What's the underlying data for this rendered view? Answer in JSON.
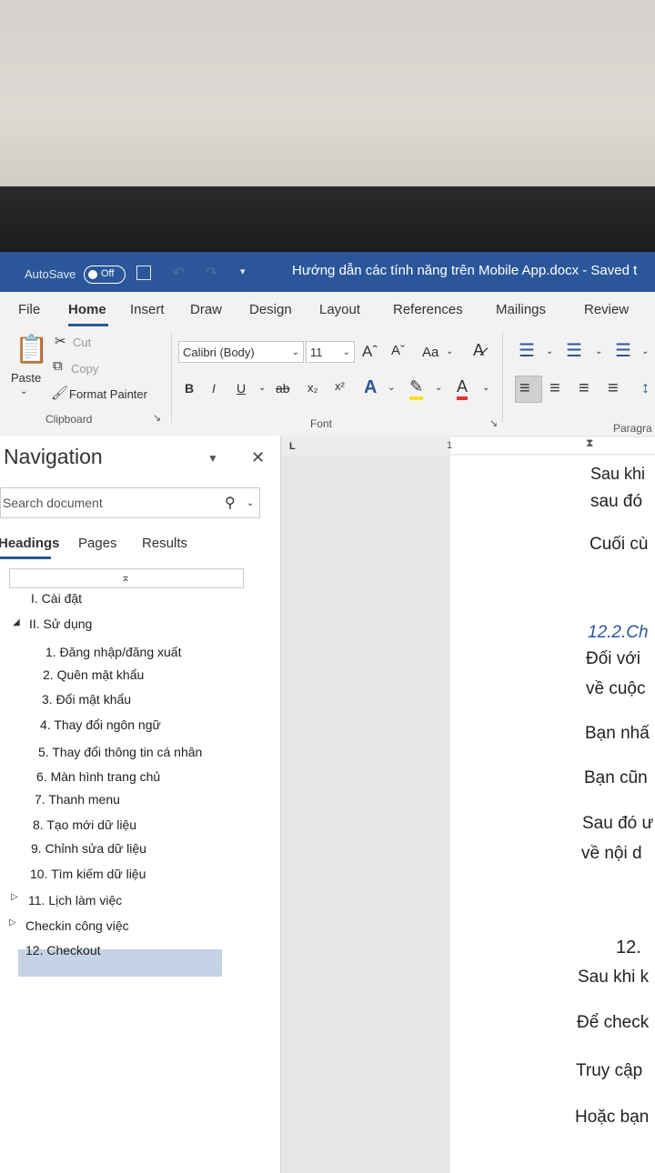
{
  "titlebar": {
    "autosave": "AutoSave",
    "toggle": "Off",
    "title": "Hướng dẫn các tính năng trên Mobile App.docx  -  Saved t"
  },
  "tabs": [
    "File",
    "Home",
    "Insert",
    "Draw",
    "Design",
    "Layout",
    "References",
    "Mailings",
    "Review"
  ],
  "clipboard": {
    "paste": "Paste",
    "cut": "Cut",
    "copy": "Copy",
    "format_painter": "Format Painter",
    "group": "Clipboard"
  },
  "font": {
    "name": "Calibri (Body)",
    "size": "11",
    "group": "Font",
    "change_case": "Aa"
  },
  "paragraph": {
    "group": "Paragra"
  },
  "nav": {
    "title": "Navigation",
    "search_placeholder": "Search document",
    "tabs": [
      "Headings",
      "Pages",
      "Results"
    ],
    "headings": [
      "I. Cài đặt",
      "II. Sử dụng",
      "1. Đăng nhập/đăng xuất",
      "2. Quên mật khẩu",
      "3. Đổi mật khẩu",
      "4. Thay đổi ngôn ngữ",
      "5. Thay đổi thông tin cá nhân",
      "6. Màn hình trang chủ",
      "7. Thanh menu",
      "8. Tạo mới dữ liệu",
      "9. Chỉnh sửa dữ liệu",
      "10. Tìm kiếm dữ liệu",
      "11. Lịch làm việc",
      "Checkin công việc",
      "12. Checkout"
    ]
  },
  "document": {
    "lines": [
      "Sau khi",
      "sau đó",
      "Cuối cù",
      "12.2.Ch",
      "Đối với",
      "về cuộc",
      "Bạn nhấ",
      "Bạn cũn",
      "Sau đó ư",
      "về nội d",
      "12.",
      "Sau khi k",
      "Để check",
      "Truy cập",
      "Hoặc bạn"
    ]
  },
  "ruler": {
    "mark": "1"
  }
}
